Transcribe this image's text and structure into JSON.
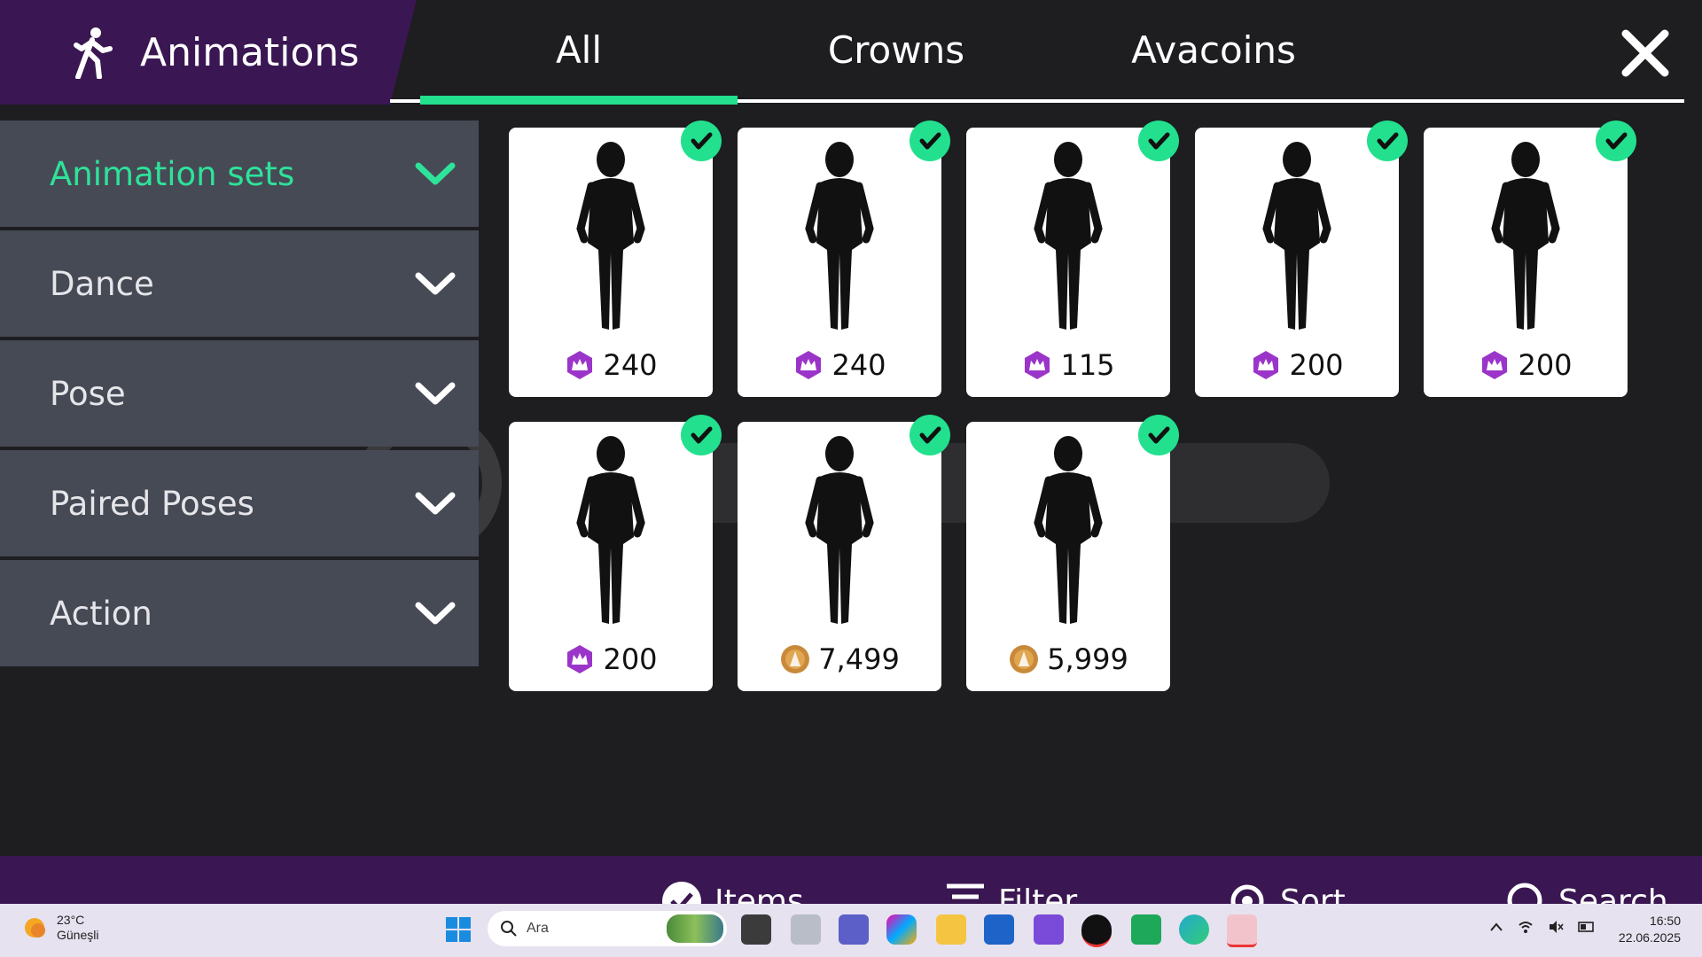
{
  "header": {
    "title": "Animations",
    "tabs": [
      {
        "label": "All",
        "active": true
      },
      {
        "label": "Crowns",
        "active": false
      },
      {
        "label": "Avacoins",
        "active": false
      }
    ]
  },
  "sidebar": {
    "items": [
      {
        "label": "Animation sets",
        "active": true
      },
      {
        "label": "Dance",
        "active": false
      },
      {
        "label": "Pose",
        "active": false
      },
      {
        "label": "Paired Poses",
        "active": false
      },
      {
        "label": "Action",
        "active": false
      }
    ]
  },
  "items": [
    {
      "price": "240",
      "currency": "crowns",
      "owned": true
    },
    {
      "price": "240",
      "currency": "crowns",
      "owned": true
    },
    {
      "price": "115",
      "currency": "crowns",
      "owned": true
    },
    {
      "price": "200",
      "currency": "crowns",
      "owned": true
    },
    {
      "price": "200",
      "currency": "crowns",
      "owned": true
    },
    {
      "price": "200",
      "currency": "crowns",
      "owned": true
    },
    {
      "price": "7,499",
      "currency": "avacoins",
      "owned": true
    },
    {
      "price": "5,999",
      "currency": "avacoins",
      "owned": true
    }
  ],
  "bottom_bar": {
    "items_label": "Items",
    "filter_label": "Filter",
    "sort_label": "Sort",
    "search_label": "Search"
  },
  "taskbar": {
    "weather_temp": "23°C",
    "weather_desc": "Güneşli",
    "search_placeholder": "Ara",
    "time": "16:50",
    "date": "22.06.2025"
  },
  "colors": {
    "accent": "#22e08e",
    "header_purple": "#3a1652",
    "sidebar_bg": "#464a55",
    "background": "#1e1d20",
    "crown_purple": "#9b35c9",
    "coin_gold": "#c88a3a"
  }
}
